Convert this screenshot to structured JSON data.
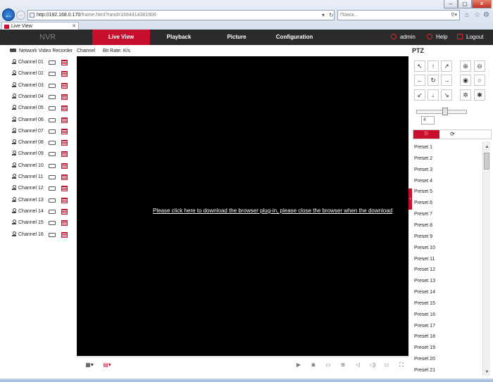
{
  "browser": {
    "url_host": "http://192.168.0.170",
    "url_path": "/frame.html?rand=1664414381906",
    "search_placeholder": "Поиск...",
    "tab_title": "Live View",
    "window_buttons": [
      "–",
      "▢",
      "✕"
    ]
  },
  "header": {
    "logo": "NVR",
    "tabs": [
      "Live View",
      "Playback",
      "Picture",
      "Configuration"
    ],
    "active_tab": "Live View",
    "user": "admin",
    "help": "Help",
    "logout": "Logout"
  },
  "channels": {
    "device": "Network Video Recorder",
    "items": [
      "Channel 01",
      "Channel 02",
      "Channel 03",
      "Channel 04",
      "Channel 05",
      "Channel 06",
      "Channel 07",
      "Channel 08",
      "Channel 09",
      "Channel 10",
      "Channel 11",
      "Channel 12",
      "Channel 13",
      "Channel 14",
      "Channel 15",
      "Channel 16"
    ]
  },
  "video": {
    "channel_label": "Channel",
    "bitrate_label": "Bit Rate: K/s",
    "plugin_message": "Please click here to download the browser plug-in, please close the browser when the download"
  },
  "ptz": {
    "title": "PTZ",
    "speed": "4",
    "presets": [
      "Preset 1",
      "Preset 2",
      "Preset 3",
      "Preset 4",
      "Preset 5",
      "Preset 6",
      "Preset 7",
      "Preset 8",
      "Preset 9",
      "Preset 10",
      "Preset 11",
      "Preset 12",
      "Preset 13",
      "Preset 14",
      "Preset 15",
      "Preset 16",
      "Preset 17",
      "Preset 18",
      "Preset 19",
      "Preset 20",
      "Preset 21"
    ]
  },
  "colors": {
    "accent": "#c8102e",
    "header_bg": "#2b2b2b",
    "video_bg": "#000000"
  }
}
